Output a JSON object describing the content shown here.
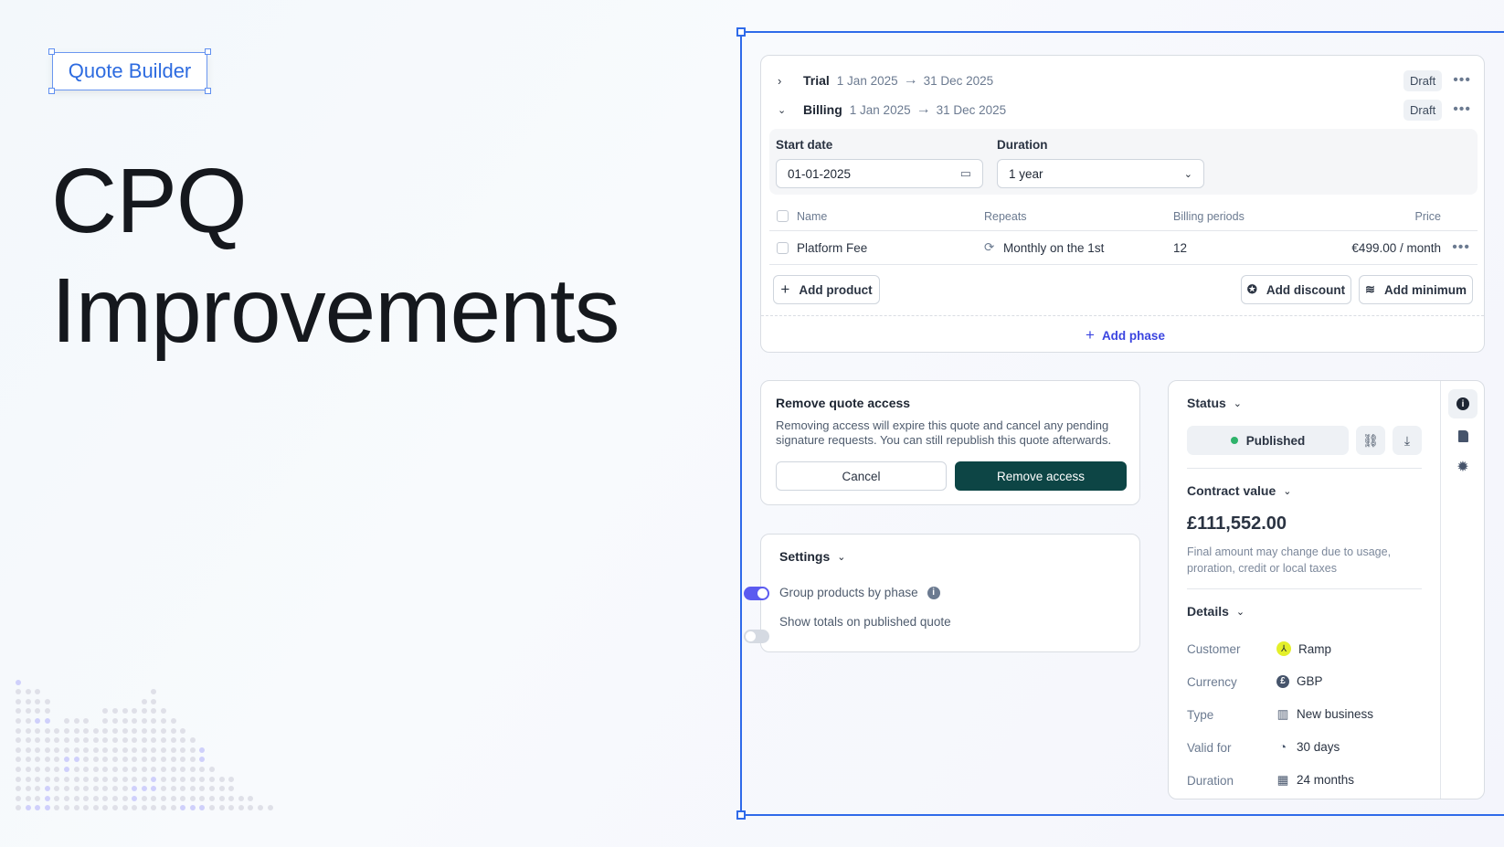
{
  "hero": {
    "tag": "Quote Builder",
    "title_line1": "CPQ",
    "title_line2": "Improvements"
  },
  "phases": [
    {
      "name": "Trial",
      "start": "1 Jan 2025",
      "end": "31 Dec 2025",
      "status": "Draft",
      "expanded": false
    },
    {
      "name": "Billing",
      "start": "1 Jan 2025",
      "end": "31 Dec 2025",
      "status": "Draft",
      "expanded": true
    }
  ],
  "billing_form": {
    "start_date_label": "Start date",
    "start_date_value": "01-01-2025",
    "duration_label": "Duration",
    "duration_value": "1 year"
  },
  "products_table": {
    "columns": [
      "Name",
      "Repeats",
      "Billing periods",
      "Price"
    ],
    "rows": [
      {
        "name": "Platform Fee",
        "repeats": "Monthly on the 1st",
        "billing_periods": "12",
        "price": "€499.00 / month"
      }
    ]
  },
  "actions": {
    "add_product": "Add product",
    "add_discount": "Add discount",
    "add_minimum": "Add minimum",
    "add_phase": "Add phase"
  },
  "remove_dialog": {
    "title": "Remove quote access",
    "body": "Removing access will expire this quote and cancel any pending signature requests. You can still republish this quote afterwards.",
    "cancel": "Cancel",
    "confirm": "Remove access"
  },
  "settings": {
    "title": "Settings",
    "items": [
      {
        "label": "Group products by phase",
        "enabled": true
      },
      {
        "label": "Show totals on published quote",
        "enabled": false
      }
    ]
  },
  "sidebar": {
    "status_title": "Status",
    "status_value": "Published",
    "contract_title": "Contract value",
    "contract_value": "£111,552.00",
    "contract_note": "Final amount may change due to usage, proration, credit or local taxes",
    "details_title": "Details",
    "details": [
      {
        "label": "Customer",
        "value": "Ramp",
        "icon": "ramp-logo-icon"
      },
      {
        "label": "Currency",
        "value": "GBP",
        "icon": "pound-icon"
      },
      {
        "label": "Type",
        "value": "New business",
        "icon": "building-icon"
      },
      {
        "label": "Valid for",
        "value": "30 days",
        "icon": "clock-icon"
      },
      {
        "label": "Duration",
        "value": "24 months",
        "icon": "calendar-icon"
      }
    ]
  },
  "colors": {
    "accent": "#2f6ae9",
    "primary_button": "#0d4545",
    "toggle_on": "#5b5bf0",
    "published": "#2fb36b",
    "link": "#3b45e0"
  }
}
